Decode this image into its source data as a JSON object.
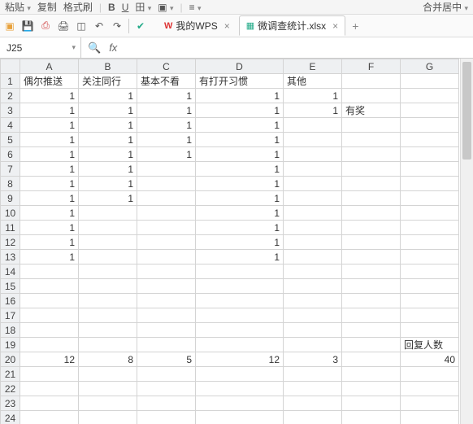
{
  "toolbar1": {
    "paste_frag": "粘贴",
    "copy": "复制",
    "format_painter": "格式刷",
    "merge_frag": "合并居中"
  },
  "tabs": {
    "wps_label": "我的WPS",
    "file_label": "微调查统计.xlsx"
  },
  "name_box": {
    "value": "J25"
  },
  "formula": {
    "value": ""
  },
  "columns": [
    "A",
    "B",
    "C",
    "D",
    "E",
    "F",
    "G"
  ],
  "row_count": 24,
  "headers_row1": {
    "A": "偶尔推送",
    "B": "关注同行",
    "C": "基本不看",
    "D": "有打开习惯",
    "E": "其他"
  },
  "cells": {
    "2": {
      "A": "1",
      "B": "1",
      "C": "1",
      "D": "1",
      "E": "1"
    },
    "3": {
      "A": "1",
      "B": "1",
      "C": "1",
      "D": "1",
      "E": "1",
      "F": "有奖"
    },
    "4": {
      "A": "1",
      "B": "1",
      "C": "1",
      "D": "1"
    },
    "5": {
      "A": "1",
      "B": "1",
      "C": "1",
      "D": "1"
    },
    "6": {
      "A": "1",
      "B": "1",
      "C": "1",
      "D": "1"
    },
    "7": {
      "A": "1",
      "B": "1",
      "D": "1"
    },
    "8": {
      "A": "1",
      "B": "1",
      "D": "1"
    },
    "9": {
      "A": "1",
      "B": "1",
      "D": "1"
    },
    "10": {
      "A": "1",
      "D": "1"
    },
    "11": {
      "A": "1",
      "D": "1"
    },
    "12": {
      "A": "1",
      "D": "1"
    },
    "13": {
      "A": "1",
      "D": "1"
    },
    "19": {
      "G": "回复人数"
    },
    "20": {
      "A": "12",
      "B": "8",
      "C": "5",
      "D": "12",
      "E": "3",
      "G": "40"
    }
  }
}
